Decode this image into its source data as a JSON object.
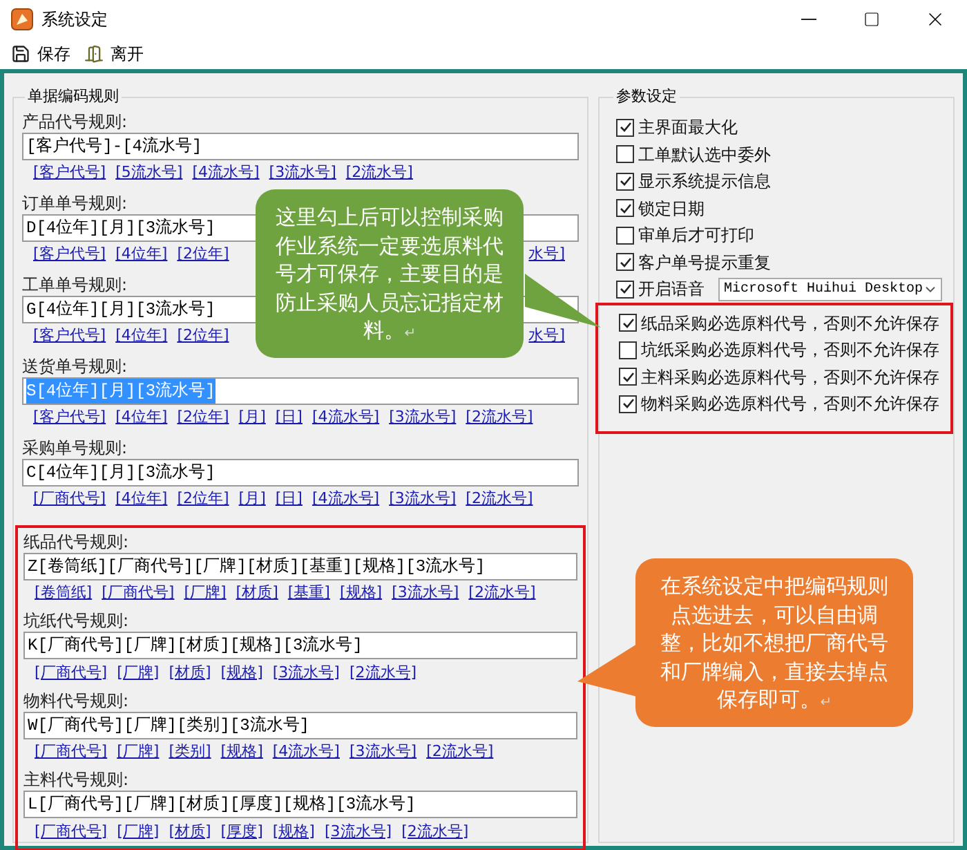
{
  "window": {
    "title": "系统设定"
  },
  "toolbar": [
    {
      "kind": "save",
      "label": "保存"
    },
    {
      "kind": "exit",
      "label": "离开"
    }
  ],
  "coding_rules": {
    "title": "单据编码规则",
    "groups": [
      {
        "highlighted": false,
        "rules": [
          {
            "label": "产品代号规则:",
            "value": "[客户代号]-[4流水号]",
            "text_selected": false,
            "links": [
              "[客户代号]",
              "[5流水号]",
              "[4流水号]",
              "[3流水号]",
              "[2流水号]"
            ]
          },
          {
            "label": "订单单号规则:",
            "value": "D[4位年][月][3流水号]",
            "text_selected": false,
            "links": [
              "[客户代号]",
              "[4位年]",
              "[2位年]"
            ],
            "trailing_fragment": "水号]"
          },
          {
            "label": "工单单号规则:",
            "value": "G[4位年][月][3流水号]",
            "text_selected": false,
            "links": [
              "[客户代号]",
              "[4位年]",
              "[2位年]"
            ],
            "trailing_fragment": "水号]"
          },
          {
            "label": "送货单号规则:",
            "value": "S[4位年][月][3流水号]",
            "text_selected": true,
            "links": [
              "[客户代号]",
              "[4位年]",
              "[2位年]",
              "[月]",
              "[日]",
              "[4流水号]",
              "[3流水号]",
              "[2流水号]"
            ]
          },
          {
            "label": "采购单号规则:",
            "value": "C[4位年][月][3流水号]",
            "text_selected": false,
            "links": [
              "[厂商代号]",
              "[4位年]",
              "[2位年]",
              "[月]",
              "[日]",
              "[4流水号]",
              "[3流水号]",
              "[2流水号]"
            ]
          }
        ]
      },
      {
        "highlighted": true,
        "rules": [
          {
            "label": "纸品代号规则:",
            "value": "Z[卷筒纸][厂商代号][厂牌][材质][基重][规格][3流水号]",
            "text_selected": false,
            "links": [
              "[卷筒纸]",
              "[厂商代号]",
              "[厂牌]",
              "[材质]",
              "[基重]",
              "[规格]",
              "[3流水号]",
              "[2流水号]"
            ]
          },
          {
            "label": "坑纸代号规则:",
            "value": "K[厂商代号][厂牌][材质][规格][3流水号]",
            "text_selected": false,
            "links": [
              "[厂商代号]",
              "[厂牌]",
              "[材质]",
              "[规格]",
              "[3流水号]",
              "[2流水号]"
            ]
          },
          {
            "label": "物料代号规则:",
            "value": "W[厂商代号][厂牌][类别][3流水号]",
            "text_selected": false,
            "links": [
              "[厂商代号]",
              "[厂牌]",
              "[类别]",
              "[规格]",
              "[4流水号]",
              "[3流水号]",
              "[2流水号]"
            ]
          },
          {
            "label": "主料代号规则:",
            "value": "L[厂商代号][厂牌][材质][厚度][规格][3流水号]",
            "text_selected": false,
            "links": [
              "[厂商代号]",
              "[厂牌]",
              "[材质]",
              "[厚度]",
              "[规格]",
              "[3流水号]",
              "[2流水号]"
            ]
          }
        ]
      }
    ]
  },
  "parameters": {
    "title": "参数设定",
    "groups": [
      {
        "highlighted": false,
        "options": [
          {
            "kind": "checkbox",
            "label": "主界面最大化",
            "checked": true
          },
          {
            "kind": "checkbox",
            "label": "工单默认选中委外",
            "checked": false
          },
          {
            "kind": "checkbox",
            "label": "显示系统提示信息",
            "checked": true
          },
          {
            "kind": "checkbox",
            "label": "锁定日期",
            "checked": true
          },
          {
            "kind": "checkbox",
            "label": "审单后才可打印",
            "checked": false
          },
          {
            "kind": "checkbox",
            "label": "客户单号提示重复",
            "checked": true
          },
          {
            "kind": "checkbox_select",
            "label": "开启语音",
            "checked": true,
            "select_value": "Microsoft Huihui Desktop"
          }
        ]
      },
      {
        "highlighted": true,
        "options": [
          {
            "kind": "checkbox",
            "label": "纸品采购必选原料代号，否则不允许保存",
            "checked": true
          },
          {
            "kind": "checkbox",
            "label": "坑纸采购必选原料代号，否则不允许保存",
            "checked": false
          },
          {
            "kind": "checkbox",
            "label": "主料采购必选原料代号，否则不允许保存",
            "checked": true
          },
          {
            "kind": "checkbox",
            "label": "物料采购必选原料代号，否则不允许保存",
            "checked": true
          }
        ]
      }
    ]
  },
  "callouts": [
    {
      "color": "#6ea33f",
      "kind": "pointer_right",
      "text": "这里勾上后可以控制采购作业系统一定要选原料代号才可保存，主要目的是防止采购人员忘记指定材料。",
      "mark": "↵"
    },
    {
      "color": "#ec7c30",
      "kind": "pointer_left",
      "text": "在系统设定中把编码规则点选进去，可以自由调整，比如不想把厂商代号和厂牌编入，直接去掉点保存即可。",
      "mark": "↵"
    }
  ]
}
